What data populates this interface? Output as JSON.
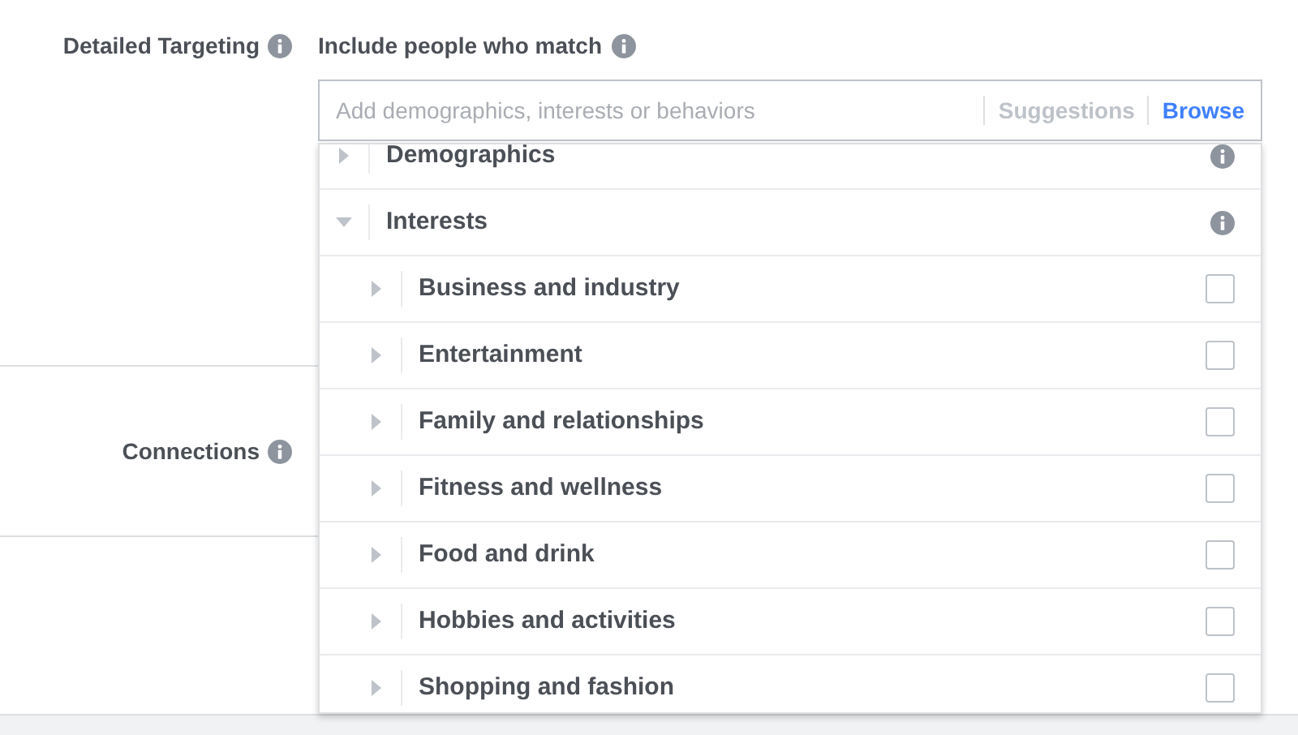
{
  "detailed_targeting": {
    "label": "Detailed Targeting",
    "include_label": "Include people who match",
    "search": {
      "placeholder": "Add demographics, interests or behaviors"
    },
    "tabs": [
      {
        "label": "Suggestions",
        "selected": false
      },
      {
        "label": "Browse",
        "selected": true
      }
    ]
  },
  "connections": {
    "label": "Connections"
  },
  "browse_tree": [
    {
      "label": "Demographics",
      "expanded": false
    },
    {
      "label": "Interests",
      "expanded": true,
      "children": [
        {
          "label": "Business and industry",
          "expanded": false,
          "checked": false
        },
        {
          "label": "Entertainment",
          "expanded": false,
          "checked": false
        },
        {
          "label": "Family and relationships",
          "expanded": false,
          "checked": false
        },
        {
          "label": "Fitness and wellness",
          "expanded": false,
          "checked": false
        },
        {
          "label": "Food and drink",
          "expanded": false,
          "checked": false
        },
        {
          "label": "Hobbies and activities",
          "expanded": false,
          "checked": false
        },
        {
          "label": "Shopping and fashion",
          "expanded": false,
          "checked": false
        }
      ]
    }
  ]
}
